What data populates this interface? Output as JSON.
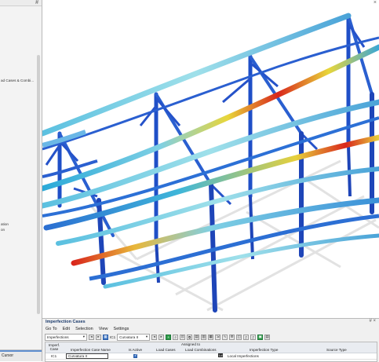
{
  "left_panel": {
    "fragments": [
      "ad Cases & Combi...",
      "ation",
      "on"
    ],
    "status_label": "Cursor"
  },
  "viewport": {
    "pin_glyph": "#",
    "close_glyph": "×"
  },
  "imperfection_panel": {
    "title": "Imperfection Cases",
    "pin_glyph": "#",
    "close_glyph": "×",
    "menu": [
      "Go To",
      "Edit",
      "Selection",
      "View",
      "Settings"
    ],
    "toolbar": {
      "category_value": "Imperfections",
      "case_id": "IC1",
      "case_value": "Curvatura II"
    },
    "table": {
      "group_header": "Assigned to",
      "columns": [
        "Imperf. Case",
        "Imperfection Case Name",
        "Is Active",
        "Load Cases",
        "Load Combinations",
        "Imperfection Type",
        "Source Type"
      ],
      "rows": [
        {
          "case": "IC1",
          "name": "Curvatura II",
          "active": true,
          "load_cases": "",
          "load_combinations": "",
          "type_badge": "Ld",
          "type": "Local Imperfections",
          "source": ""
        }
      ]
    }
  },
  "colors": {
    "member_blue": "#1f4fc7",
    "member_light": "#6ab7e6",
    "panel_title": "#1b3a6b",
    "accent_red": "#d9271c",
    "accent_yellow": "#e8d63a"
  }
}
